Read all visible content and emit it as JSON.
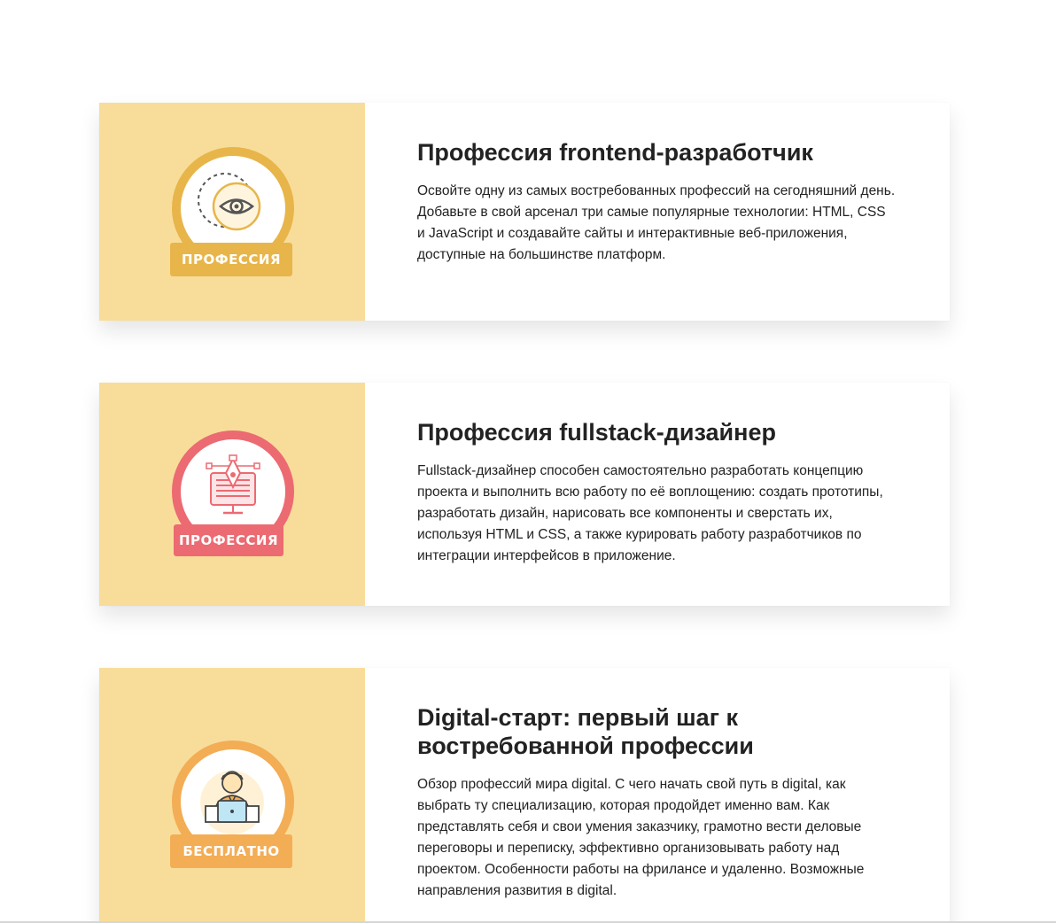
{
  "colors": {
    "card_media_bg": "#f8dd9a",
    "badge_frontend": "#e8b54a",
    "badge_fullstack": "#ec6a72",
    "badge_digital": "#f3ad55"
  },
  "courses": [
    {
      "title": "Профессия frontend-разработчик",
      "description": "Освойте одну из самых востребованных профессий на сегодняшний день. Добавьте в свой арсенал три самые популярные технологии: HTML, CSS и JavaScript и создавайте сайты и интерактивные веб-приложения, доступные на большинстве платформ.",
      "badge_label": "ПРОФЕССИЯ",
      "icon": "eye-icon"
    },
    {
      "title": "Профессия fullstack-дизайнер",
      "description": "Fullstack-дизайнер способен самостоятельно разработать концепцию проекта и выполнить всю работу по её воплощению: создать прототипы, разработать дизайн, нарисовать все компоненты и сверстать их, используя HTML и CSS, а также курировать работу разработчиков по интеграции интерфейсов в приложение.",
      "badge_label": "ПРОФЕССИЯ",
      "icon": "pen-tool-monitor-icon"
    },
    {
      "title": "Digital-старт: первый шаг к востребованной профессии",
      "description": "Обзор профессий мира digital. С чего начать свой путь в digital, как выбрать ту специализацию, которая продойдет именно вам. Как представлять себя и свои умения заказчику, грамотно вести деловые переговоры и переписку, эффективно организовывать работу над проектом. Особенности работы на фрилансе и удаленно. Возможные направления развития в digital.",
      "badge_label": "БЕСПЛАТНО",
      "icon": "person-laptop-icon"
    }
  ]
}
